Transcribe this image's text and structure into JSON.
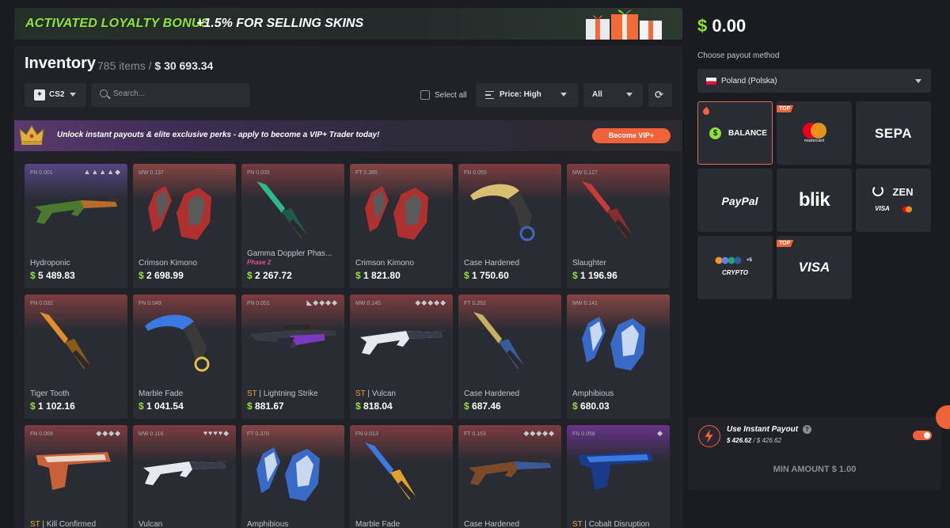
{
  "banner": {
    "title": "ACTIVATED LOYALTY BONUS",
    "bonus": "+1.5% FOR SELLING SKINS"
  },
  "inventory": {
    "title": "Inventory",
    "count": "785 items /",
    "value_prefix": "$",
    "value": "30 693.34",
    "game": "CS2",
    "search_placeholder": "Search...",
    "select_all": "Select all",
    "sort": "Price: High",
    "filter": "All"
  },
  "vip": {
    "text": "Unlock instant payouts & elite exclusive perks - apply to become a VIP+ Trader today!",
    "button": "Become VIP+"
  },
  "items": [
    {
      "float": "FN 0.001",
      "stickers": "▲▲▲▲◆",
      "name": "Hydroponic",
      "st": "",
      "phase": "",
      "price": "5 489.83",
      "glow": "#7a5cc8",
      "kind": "rifle",
      "c1": "#4a7a2e",
      "c2": "#b86b2a"
    },
    {
      "float": "MW 0.137",
      "stickers": "",
      "name": "Crimson Kimono",
      "st": "",
      "phase": "",
      "price": "2 698.99",
      "glow": "#d05a52",
      "kind": "glove",
      "c1": "#b03030",
      "c2": "#5a5a5a"
    },
    {
      "float": "FN 0.035",
      "stickers": "",
      "name": "Gamma Doppler Phas...",
      "st": "",
      "phase": "Phase 2",
      "price": "2 267.72",
      "glow": "#b5484a",
      "kind": "knife",
      "c1": "#2fb88a",
      "c2": "#1e5a4a"
    },
    {
      "float": "FT 0.365",
      "stickers": "",
      "name": "Crimson Kimono",
      "st": "",
      "phase": "",
      "price": "1 821.80",
      "glow": "#d05a52",
      "kind": "glove",
      "c1": "#b03030",
      "c2": "#5a5a5a"
    },
    {
      "float": "FN 0.055",
      "stickers": "",
      "name": "Case Hardened",
      "st": "",
      "phase": "",
      "price": "1 750.60",
      "glow": "#c24a4a",
      "kind": "karambit",
      "c1": "#d8c070",
      "c2": "#3a6ac0"
    },
    {
      "float": "MW 0.127",
      "stickers": "",
      "name": "Slaughter",
      "st": "",
      "phase": "",
      "price": "1 196.96",
      "glow": "#c24a4a",
      "kind": "knife",
      "c1": "#c83a3a",
      "c2": "#8a2a2a"
    },
    {
      "float": "FN 0.032",
      "stickers": "",
      "name": "Tiger Tooth",
      "st": "",
      "phase": "",
      "price": "1 102.16",
      "glow": "#c24a4a",
      "kind": "knife",
      "c1": "#e0902a",
      "c2": "#8a5a1a"
    },
    {
      "float": "FN 0.049",
      "stickers": "",
      "name": "Marble Fade",
      "st": "",
      "phase": "",
      "price": "1 041.54",
      "glow": "#c24a4a",
      "kind": "karambit",
      "c1": "#3a7ae0",
      "c2": "#e0c040"
    },
    {
      "float": "FN 0.051",
      "stickers": "◣◆◆◆◆",
      "name": "Lightning Strike",
      "st": "ST",
      "phase": "",
      "price": "881.67",
      "glow": "#c24a4a",
      "kind": "awp",
      "c1": "#7a3ac0",
      "c2": "#2a2a3a"
    },
    {
      "float": "MW 0.145",
      "stickers": "◆◆◆◆◆",
      "name": "Vulcan",
      "st": "ST",
      "phase": "",
      "price": "818.04",
      "glow": "#c24a4a",
      "kind": "rifle",
      "c1": "#e8e8f0",
      "c2": "#3a3a4a"
    },
    {
      "float": "FT 0.262",
      "stickers": "",
      "name": "Case Hardened",
      "st": "",
      "phase": "",
      "price": "687.46",
      "glow": "#c24a4a",
      "kind": "knife",
      "c1": "#c8b060",
      "c2": "#3a5a9a"
    },
    {
      "float": "MW 0.141",
      "stickers": "",
      "name": "Amphibious",
      "st": "",
      "phase": "",
      "price": "680.03",
      "glow": "#d05a52",
      "kind": "glove",
      "c1": "#3a6ac8",
      "c2": "#c8d8f0"
    },
    {
      "float": "FN 0.069",
      "stickers": "◆◆◆◆",
      "name": "Kill Confirmed",
      "st": "ST",
      "phase": "",
      "price": "",
      "glow": "#c24a4a",
      "kind": "pistol",
      "c1": "#c8603a",
      "c2": "#e8d8c8"
    },
    {
      "float": "MW 0.116",
      "stickers": "♥♥♥♥◆",
      "name": "Vulcan",
      "st": "",
      "phase": "",
      "price": "",
      "glow": "#c24a4a",
      "kind": "rifle",
      "c1": "#e8e8f0",
      "c2": "#3a3a4a"
    },
    {
      "float": "FT 0.370",
      "stickers": "",
      "name": "Amphibious",
      "st": "",
      "phase": "",
      "price": "",
      "glow": "#d05a52",
      "kind": "glove",
      "c1": "#3a6ac8",
      "c2": "#c8d8f0"
    },
    {
      "float": "FN 0.013",
      "stickers": "",
      "name": "Marble Fade",
      "st": "",
      "phase": "",
      "price": "",
      "glow": "#c24a4a",
      "kind": "knife",
      "c1": "#3a7ae0",
      "c2": "#e0a030"
    },
    {
      "float": "FT 0.153",
      "stickers": "◆◆◆◆◆",
      "name": "Case Hardened",
      "st": "",
      "phase": "",
      "price": "",
      "glow": "#c24a4a",
      "kind": "rifle",
      "c1": "#7a4a2a",
      "c2": "#3a5a9a"
    },
    {
      "float": "FN 0.058",
      "stickers": "◆",
      "name": "Cobalt Disruption",
      "st": "ST",
      "phase": "",
      "price": "",
      "glow": "#9a3ad0",
      "kind": "pistol",
      "c1": "#1a3a8a",
      "c2": "#3a7ae0"
    }
  ],
  "sidebar": {
    "balance_prefix": "$",
    "balance": "0.00",
    "payout_label": "Choose payout method",
    "country": "Poland (Polska)",
    "methods": {
      "balance": "BALANCE",
      "top": "TOP",
      "mastercard": "mastercard",
      "sepa": "SEPA",
      "paypal": "PayPal",
      "blik": "blik",
      "zen": "ZEN",
      "visa": "VISA",
      "crypto": "CRYPTO",
      "plus5": "+5"
    }
  },
  "instant": {
    "title": "Use Instant Payout",
    "amount": "$ 426.62",
    "total": " / $ 426.62",
    "min": "MIN AMOUNT $ 1.00"
  },
  "colors": {
    "accent": "#f0623a",
    "green": "#8fe03a",
    "bg": "#1a1c21",
    "panel": "#202228",
    "card": "#2a2c33"
  }
}
